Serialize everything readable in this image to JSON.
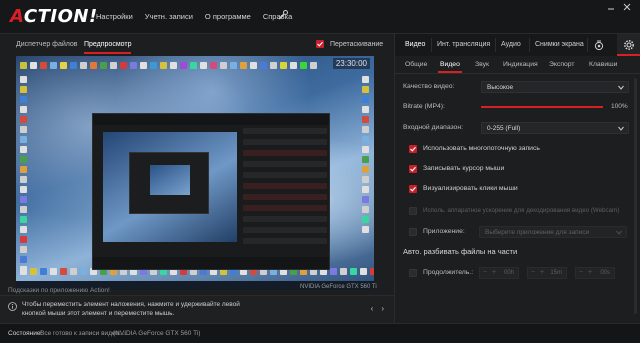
{
  "app": {
    "logo_text": "ACTION!"
  },
  "topmenu": [
    "Настройки",
    "Учетн. записи",
    "О программе",
    "Справка"
  ],
  "left": {
    "tabs": [
      "Диспетчер файлов",
      "Предпросмотр"
    ],
    "active_tab": 1,
    "drag_label": "Перетаскивание",
    "drag_checked": true,
    "preview_clock": "23:30:00",
    "preview_gpu": "NVIDIA GeForce GTX 560 Ti",
    "hints_title": "Подсказки по приложению Action!",
    "hint_text": "Чтобы переместить элемент наложения, нажмите и удерживайте левой кнопкой мыши этот элемент и переместите мышь."
  },
  "right": {
    "tabs": [
      "Видео",
      "Инт. трансляция",
      "Аудио",
      "Снимки экрана"
    ],
    "icons": [
      "webcam-icon",
      "gear-icon"
    ],
    "subtabs": [
      "Общие",
      "Видео",
      "Звук",
      "Индикация",
      "Экспорт",
      "Клавиши"
    ],
    "active_subtab": 1,
    "quality_label": "Качество видео:",
    "quality_value": "Высокое",
    "bitrate_label": "Bitrate (MP4):",
    "bitrate_value": "100%",
    "bitrate_fraction": 1.0,
    "range_label": "Входной диапазон:",
    "range_value": "0-255 (Full)",
    "checkboxes": [
      {
        "label": "Использовать многопоточную запись",
        "checked": true,
        "enabled": true
      },
      {
        "label": "Записывать курсор мыши",
        "checked": true,
        "enabled": true
      },
      {
        "label": "Визуализировать клики мыши",
        "checked": true,
        "enabled": true
      },
      {
        "label": "Исполь. аппаратное ускорение для декодирования видео (Webcam)",
        "checked": false,
        "enabled": false
      }
    ],
    "app_label": "Приложение:",
    "app_value": "Выберите приложение для записи",
    "split_title": "Авто. разбивать файлы на части",
    "duration_label": "Продолжитель.:",
    "spinners": [
      "00h",
      "15m",
      "00s"
    ]
  },
  "status": {
    "label": "Состояние:",
    "text": "Все готово к записи видео....",
    "gpu": "(NVIDIA GeForce GTX 560 Ti)"
  },
  "colors": {
    "accent": "#d81f26",
    "background": "#1d1e20"
  }
}
